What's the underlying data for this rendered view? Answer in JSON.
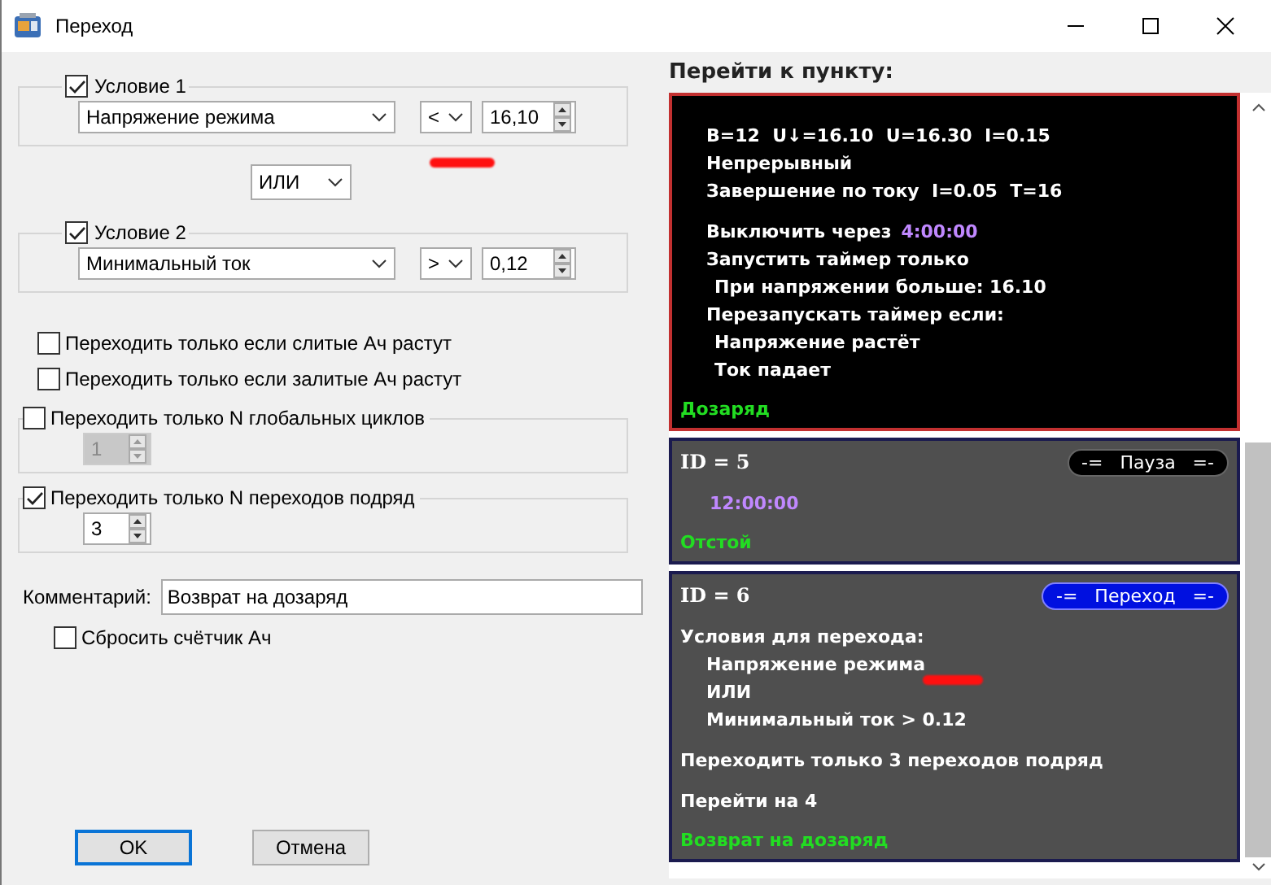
{
  "window": {
    "title": "Переход"
  },
  "conditions": [
    {
      "label": "Условие 1",
      "checked": true,
      "parameter": "Напряжение режима",
      "operator": "<",
      "value": "16,10"
    },
    {
      "label": "Условие 2",
      "checked": true,
      "parameter": "Минимальный ток",
      "operator": ">",
      "value": "0,12"
    }
  ],
  "logic": "ИЛИ",
  "options": [
    {
      "kind": "checkbox",
      "label": "Переходить только если слитые Ач растут",
      "checked": false
    },
    {
      "kind": "checkbox",
      "label": "Переходить только если залитые Ач растут",
      "checked": false
    },
    {
      "kind": "group",
      "label": "Переходить только N глобальных циклов",
      "checked": false,
      "value": "1"
    },
    {
      "kind": "group",
      "label": "Переходить только N переходов подряд",
      "checked": true,
      "value": "3"
    }
  ],
  "comment": {
    "label": "Комментарий:",
    "value": "Возврат на дозаряд"
  },
  "reset_counter": {
    "label": "Сбросить счётчик Ач",
    "checked": false
  },
  "buttons": [
    {
      "label": "OK",
      "focused": true
    },
    {
      "label": "Отмена",
      "focused": false
    }
  ],
  "goto": {
    "heading": "Перейти к пункту:",
    "cards": [
      {
        "selected": true,
        "blocks": [
          [
            {
              "text": "B=12  U↓=16.10  U=16.30  I=0.15"
            },
            {
              "text": "Непрерывный"
            },
            {
              "text": "Завершение по току  I=0.05  T=16"
            }
          ],
          [
            {
              "text": "Выключить через",
              "time": "4:00:00"
            },
            {
              "text": "Запустить таймер только",
              "children": [
                {
                  "text": "При напряжении больше: 16.10"
                }
              ]
            },
            {
              "text": "Перезапускать таймер если:",
              "children": [
                {
                  "text": "Напряжение растёт"
                },
                {
                  "text": "Ток падает"
                }
              ]
            }
          ]
        ],
        "footer": "Дозаряд"
      },
      {
        "selected": false,
        "id": "ID = 5",
        "badge": {
          "kind": "pause",
          "text": "-=   Пауза   =-"
        },
        "blocks": [
          [
            {
              "children": [
                {
                  "time": "12:00:00"
                }
              ]
            }
          ]
        ],
        "footer": "Отстой"
      },
      {
        "selected": false,
        "id": "ID = 6",
        "badge": {
          "kind": "transition",
          "text": "-=   Переход   =-"
        },
        "blocks": [
          [
            {
              "text": "Условия для перехода:",
              "children": [
                {
                  "text": "Напряжение режима"
                },
                {
                  "text": "ИЛИ"
                },
                {
                  "text": "Минимальный ток > 0.12"
                }
              ]
            }
          ],
          [
            {
              "text": "Переходить только 3 переходов подряд"
            }
          ],
          [
            {
              "text": "Перейти на 4"
            }
          ]
        ],
        "footer": "Возврат на дозаряд"
      }
    ]
  }
}
